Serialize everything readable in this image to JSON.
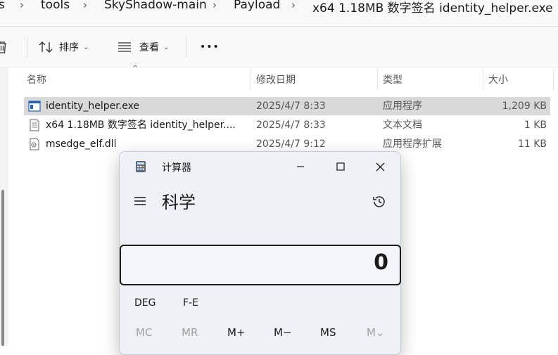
{
  "breadcrumb": {
    "items": [
      "s",
      "tools",
      "SkyShadow-main",
      "Payload",
      "x64 1.18MB 数字签名 identity_helper.exe"
    ]
  },
  "toolbar": {
    "sort_label": "排序",
    "view_label": "查看",
    "more_label": "•••"
  },
  "columns": {
    "name": "名称",
    "date": "修改日期",
    "type": "类型",
    "size": "大小"
  },
  "files": [
    {
      "name": "identity_helper.exe",
      "date": "2025/4/7 8:33",
      "type": "应用程序",
      "size": "1,209 KB",
      "icon": "exe-icon",
      "selected": true
    },
    {
      "name": "x64 1.18MB 数字签名 identity_helper....",
      "date": "2025/4/7 8:33",
      "type": "文本文档",
      "size": "1 KB",
      "icon": "text-file-icon",
      "selected": false
    },
    {
      "name": "msedge_elf.dll",
      "date": "2025/4/7 9:12",
      "type": "应用程序扩展",
      "size": "11 KB",
      "icon": "dll-icon",
      "selected": false
    }
  ],
  "calculator": {
    "title": "计算器",
    "mode": "科学",
    "display": "0",
    "functions": {
      "deg": "DEG",
      "fe": "F-E"
    },
    "memory": {
      "mc": "MC",
      "mr": "MR",
      "mplus": "M+",
      "mminus": "M−",
      "ms": "MS",
      "mlist": "M⌄"
    }
  },
  "colors": {
    "selected_row": "#d9d9d9",
    "calc_bg": "#eef1f6",
    "display_border": "#1c1c1c"
  }
}
